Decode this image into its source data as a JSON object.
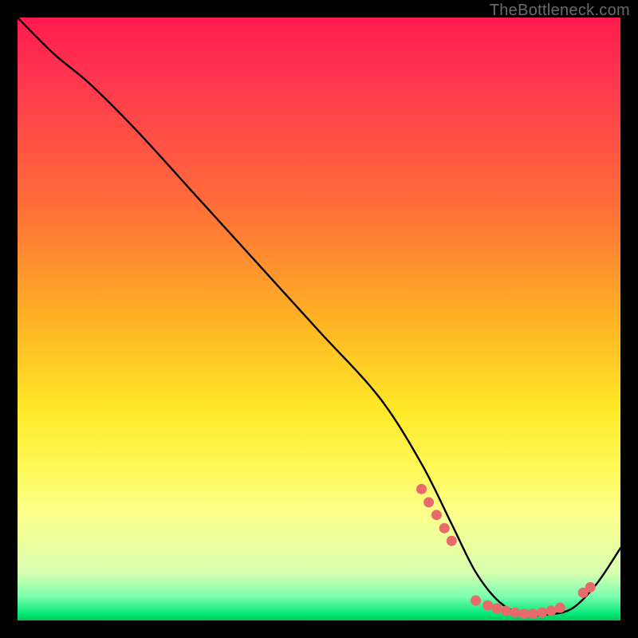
{
  "watermark": "TheBottleneck.com",
  "chart_data": {
    "type": "line",
    "title": "",
    "xlabel": "",
    "ylabel": "",
    "xlim": [
      0,
      100
    ],
    "ylim": [
      0,
      100
    ],
    "series": [
      {
        "name": "bottleneck-curve",
        "x": [
          0,
          6,
          12,
          20,
          30,
          40,
          50,
          60,
          67,
          72,
          76,
          80,
          84,
          88,
          92,
          96,
          100
        ],
        "y": [
          100,
          94,
          89,
          81,
          70,
          59,
          48,
          37,
          26,
          16,
          8,
          3,
          1,
          1,
          2,
          6,
          12
        ]
      }
    ],
    "markers": {
      "name": "highlight-dots",
      "color": "#e86a6a",
      "points": [
        {
          "x": 67.0,
          "y": 21.8
        },
        {
          "x": 68.2,
          "y": 19.6
        },
        {
          "x": 69.5,
          "y": 17.5
        },
        {
          "x": 70.8,
          "y": 15.3
        },
        {
          "x": 72.0,
          "y": 13.2
        },
        {
          "x": 76.0,
          "y": 3.3
        },
        {
          "x": 78.0,
          "y": 2.5
        },
        {
          "x": 79.5,
          "y": 2.0
        },
        {
          "x": 81.0,
          "y": 1.6
        },
        {
          "x": 82.5,
          "y": 1.3
        },
        {
          "x": 84.0,
          "y": 1.1
        },
        {
          "x": 85.5,
          "y": 1.1
        },
        {
          "x": 87.0,
          "y": 1.3
        },
        {
          "x": 88.5,
          "y": 1.6
        },
        {
          "x": 90.0,
          "y": 2.1
        },
        {
          "x": 93.8,
          "y": 4.6
        },
        {
          "x": 95.0,
          "y": 5.5
        }
      ]
    }
  }
}
